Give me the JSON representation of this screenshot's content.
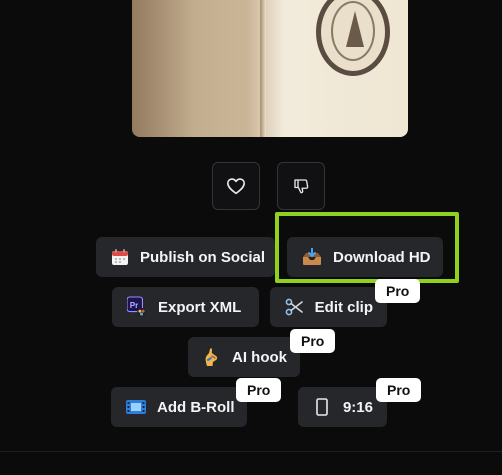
{
  "reactions": {
    "like_icon": "heart-icon",
    "dislike_icon": "thumbs-down-icon"
  },
  "actions": {
    "publish": "Publish on Social",
    "download": "Download HD",
    "export_xml": "Export XML",
    "edit_clip": "Edit clip",
    "ai_hook": "AI hook",
    "add_broll": "Add B-Roll",
    "aspect_ratio": "9:16"
  },
  "badges": {
    "pro": "Pro"
  },
  "colors": {
    "highlight": "#8fd11e",
    "pill_bg": "#26272b",
    "page_bg": "#0b0b0c"
  }
}
